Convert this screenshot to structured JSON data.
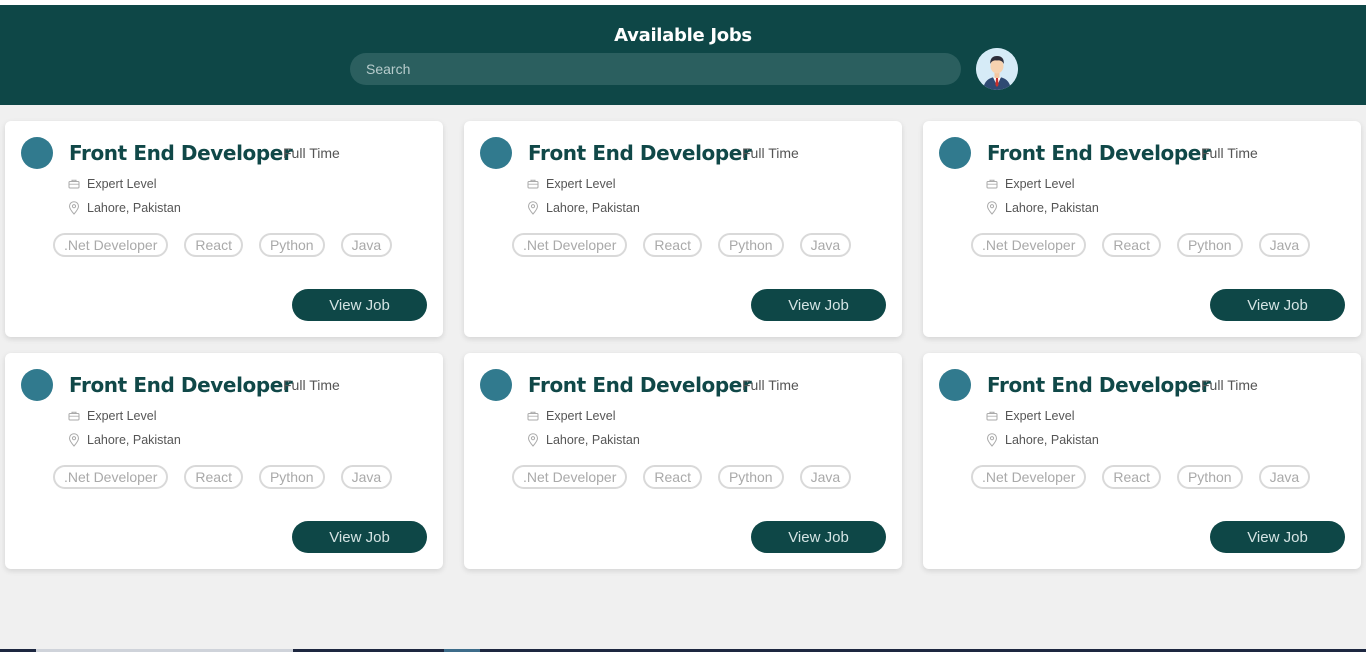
{
  "header": {
    "title": "Available Jobs",
    "search_placeholder": "Search",
    "search_value": "",
    "avatar_icon": "user-avatar-icon"
  },
  "colors": {
    "header_bg": "#0e4747",
    "accent": "#0e4747",
    "company_logo": "#317a8e",
    "page_bg": "#f0f0f0"
  },
  "jobs": [
    {
      "title": "Front End Developer",
      "type": "Full Time",
      "level": "Expert Level",
      "location": "Lahore, Pakistan",
      "tags": [
        ".Net Developer",
        "React",
        "Python",
        "Java"
      ],
      "button": "View Job"
    },
    {
      "title": "Front End Developer",
      "type": "Full Time",
      "level": "Expert Level",
      "location": "Lahore, Pakistan",
      "tags": [
        ".Net Developer",
        "React",
        "Python",
        "Java"
      ],
      "button": "View Job"
    },
    {
      "title": "Front End Developer",
      "type": "Full Time",
      "level": "Expert Level",
      "location": "Lahore, Pakistan",
      "tags": [
        ".Net Developer",
        "React",
        "Python",
        "Java"
      ],
      "button": "View Job"
    },
    {
      "title": "Front End Developer",
      "type": "Full Time",
      "level": "Expert Level",
      "location": "Lahore, Pakistan",
      "tags": [
        ".Net Developer",
        "React",
        "Python",
        "Java"
      ],
      "button": "View Job"
    },
    {
      "title": "Front End Developer",
      "type": "Full Time",
      "level": "Expert Level",
      "location": "Lahore, Pakistan",
      "tags": [
        ".Net Developer",
        "React",
        "Python",
        "Java"
      ],
      "button": "View Job"
    },
    {
      "title": "Front End Developer",
      "type": "Full Time",
      "level": "Expert Level",
      "location": "Lahore, Pakistan",
      "tags": [
        ".Net Developer",
        "React",
        "Python",
        "Java"
      ],
      "button": "View Job"
    }
  ]
}
